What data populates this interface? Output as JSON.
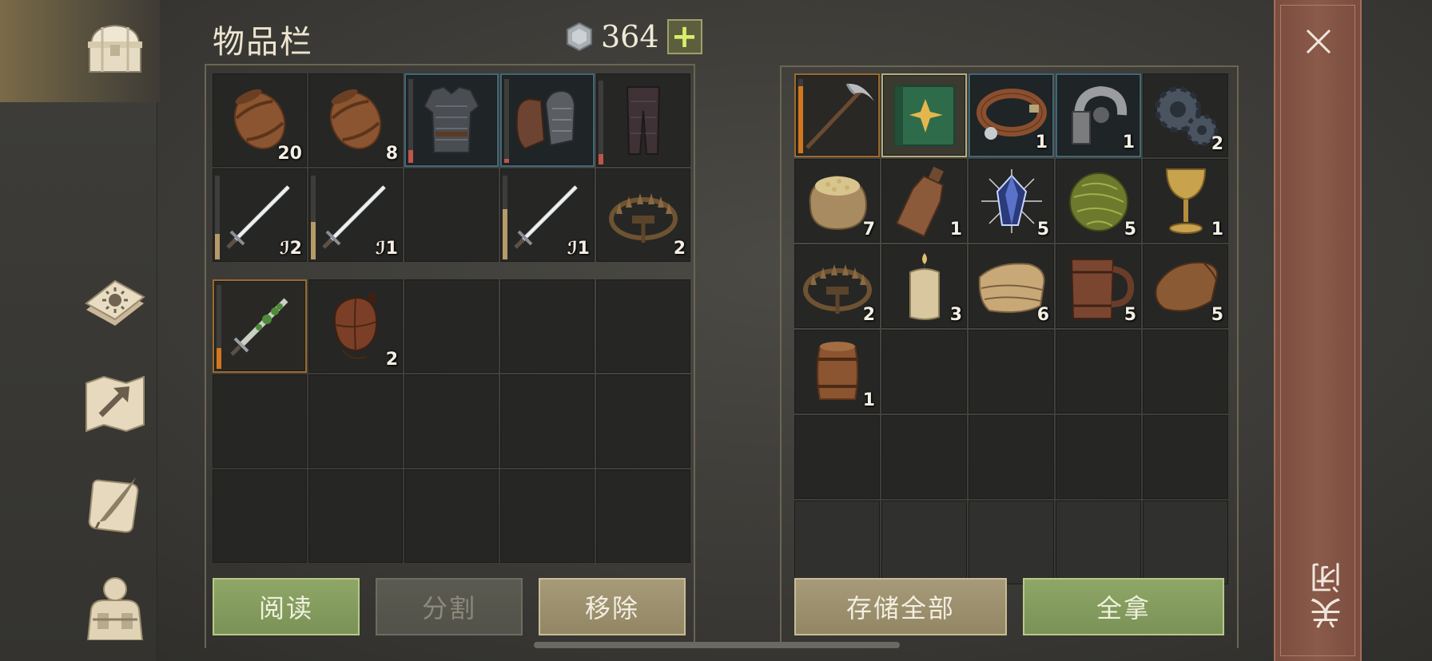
{
  "header": {
    "title": "物品栏",
    "currency": "364",
    "add_label": "+"
  },
  "nav": [
    {
      "name": "inventory",
      "icon": "chest-icon",
      "active": true
    },
    {
      "name": "skills",
      "icon": "sun-book-icon",
      "active": false
    },
    {
      "name": "map",
      "icon": "map-arrow-icon",
      "active": false
    },
    {
      "name": "journal",
      "icon": "quill-scroll-icon",
      "active": false
    },
    {
      "name": "character",
      "icon": "character-bust-icon",
      "active": false
    }
  ],
  "equipment": [
    {
      "icon": "barrel-icon",
      "qty": "20"
    },
    {
      "icon": "barrel-icon",
      "qty": "8"
    },
    {
      "icon": "chainmail-armor-icon",
      "qty": "",
      "highlight": "blue",
      "durability": 0.15,
      "dur_color": "#c0554a"
    },
    {
      "icon": "chainmail-gloves-icon",
      "qty": "",
      "highlight": "blue",
      "durability": 0.05,
      "dur_color": "#c0554a"
    },
    {
      "icon": "leggings-icon",
      "qty": "",
      "durability": 0.12,
      "dur_color": "#c0554a"
    },
    {
      "icon": "sword-icon",
      "qty": "ℐ2",
      "durability": 0.3,
      "dur_color": "#b69a68"
    },
    {
      "icon": "sword-icon",
      "qty": "ℐ1",
      "durability": 0.45,
      "dur_color": "#b69a68"
    },
    {
      "icon": "",
      "qty": ""
    },
    {
      "icon": "sword-icon",
      "qty": "ℐ1",
      "durability": 0.6,
      "dur_color": "#b69a68"
    },
    {
      "icon": "bear-trap-icon",
      "qty": "2"
    }
  ],
  "bag": [
    {
      "icon": "poison-dagger-icon",
      "qty": "",
      "highlight": "orange",
      "durability": 0.25,
      "dur_color": "#d2771e"
    },
    {
      "icon": "waterskin-icon",
      "qty": "2"
    },
    {
      "icon": "",
      "qty": ""
    },
    {
      "icon": "",
      "qty": ""
    },
    {
      "icon": "",
      "qty": ""
    },
    {
      "icon": "",
      "qty": ""
    },
    {
      "icon": "",
      "qty": ""
    },
    {
      "icon": "",
      "qty": ""
    },
    {
      "icon": "",
      "qty": ""
    },
    {
      "icon": "",
      "qty": ""
    },
    {
      "icon": "",
      "qty": ""
    },
    {
      "icon": "",
      "qty": ""
    },
    {
      "icon": "",
      "qty": ""
    },
    {
      "icon": "",
      "qty": ""
    },
    {
      "icon": "",
      "qty": ""
    }
  ],
  "storage": [
    {
      "icon": "pickaxe-icon",
      "qty": "",
      "highlight": "orange",
      "durability": 0.9,
      "dur_color": "#d2771e"
    },
    {
      "icon": "green-book-icon",
      "qty": "",
      "highlight": "gold"
    },
    {
      "icon": "leather-collar-icon",
      "qty": "1",
      "highlight": "blue"
    },
    {
      "icon": "iron-shackle-icon",
      "qty": "1",
      "highlight": "blue"
    },
    {
      "icon": "gears-icon",
      "qty": "2"
    },
    {
      "icon": "grain-sack-icon",
      "qty": "7"
    },
    {
      "icon": "clay-bottle-icon",
      "qty": "1"
    },
    {
      "icon": "crystal-icon",
      "qty": "5"
    },
    {
      "icon": "herb-ball-icon",
      "qty": "5"
    },
    {
      "icon": "goblet-icon",
      "qty": "1"
    },
    {
      "icon": "bear-trap-icon",
      "qty": "2"
    },
    {
      "icon": "candle-icon",
      "qty": "3"
    },
    {
      "icon": "cloth-icon",
      "qty": "6"
    },
    {
      "icon": "tankard-icon",
      "qty": "5"
    },
    {
      "icon": "leather-scrap-icon",
      "qty": "5"
    },
    {
      "icon": "small-barrel-icon",
      "qty": "1"
    },
    {
      "icon": "",
      "qty": ""
    },
    {
      "icon": "",
      "qty": ""
    },
    {
      "icon": "",
      "qty": ""
    },
    {
      "icon": "",
      "qty": ""
    },
    {
      "icon": "",
      "qty": ""
    },
    {
      "icon": "",
      "qty": ""
    },
    {
      "icon": "",
      "qty": ""
    },
    {
      "icon": "",
      "qty": ""
    },
    {
      "icon": "",
      "qty": ""
    },
    {
      "icon": "",
      "qty": "",
      "dim": true
    },
    {
      "icon": "",
      "qty": "",
      "dim": true
    },
    {
      "icon": "",
      "qty": "",
      "dim": true
    },
    {
      "icon": "",
      "qty": "",
      "dim": true
    },
    {
      "icon": "",
      "qty": "",
      "dim": true
    }
  ],
  "buttons": {
    "read": "阅读",
    "split": "分割",
    "remove": "移除",
    "store_all": "存储全部",
    "take_all": "全拿"
  },
  "close": {
    "label": "关闭"
  }
}
